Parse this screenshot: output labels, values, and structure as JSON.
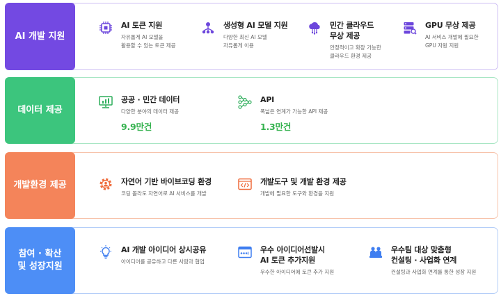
{
  "sections": [
    {
      "label": "AI 개발 지원",
      "color": "#7349e2",
      "border": "#cdbdf4",
      "items": [
        {
          "title": "AI 토큰 지원",
          "desc": "자유롭게 AI 모델을\n활용할 수 있는 토큰 제공",
          "icon": "chip-icon"
        },
        {
          "title": "생성형 AI 모델 지원",
          "desc": "다양한 최신 AI 모델\n자유롭게 이용",
          "icon": "network-icon"
        },
        {
          "title": "민간 클라우드\n무상 제공",
          "desc": "안정적이고 확장 가능한\n클라우드 환경 제공",
          "icon": "cloud-icon"
        },
        {
          "title": "GPU 무상 제공",
          "desc": "AI 서비스 개발에 필요한\nGPU 자원 지원",
          "icon": "server-icon"
        }
      ]
    },
    {
      "label": "데이터 제공",
      "color": "#3cc57d",
      "border": "#a8e6c4",
      "items": [
        {
          "title": "공공 · 민간 데이터",
          "desc": "다양한 분야의 데이터 제공",
          "stat": "9.9만건",
          "icon": "monitor-chart-icon"
        },
        {
          "title": "API",
          "desc": "폭넓은 연계가 가능한 API 제공",
          "stat": "1.3만건",
          "icon": "api-nodes-icon"
        }
      ]
    },
    {
      "label": "개발환경 제공",
      "color": "#f4845a",
      "border": "#f7c3ab",
      "items": [
        {
          "title": "자연어 기반 바이브코딩 환경",
          "desc": "코딩 몰라도 자연어로 AI 서비스를 개발",
          "icon": "gear-person-icon"
        },
        {
          "title": "개발도구 및 개발 환경 제공",
          "desc": "개발에 필요한 도구와 환경을 지원",
          "icon": "code-window-icon"
        }
      ]
    },
    {
      "label": "참여 · 확산\n및 성장지원",
      "color": "#4d8ef6",
      "border": "#b3cdf8",
      "items": [
        {
          "title": "AI 개발 아이디어 상시공유",
          "desc": "아이디어를 공유하고 다른 사람과 협업",
          "icon": "lightbulb-icon"
        },
        {
          "title": "우수 아이디어선발시\nAI 토큰 추가지원",
          "desc": "우수한 아이디어에 토큰 추가 지원",
          "icon": "password-window-icon"
        },
        {
          "title": "우수팀 대상 맞춤형\n컨설팅 · 사업화 연계",
          "desc": "컨설팅과 사업화 연계를 통한 성장 지원",
          "icon": "team-icon"
        }
      ]
    }
  ]
}
